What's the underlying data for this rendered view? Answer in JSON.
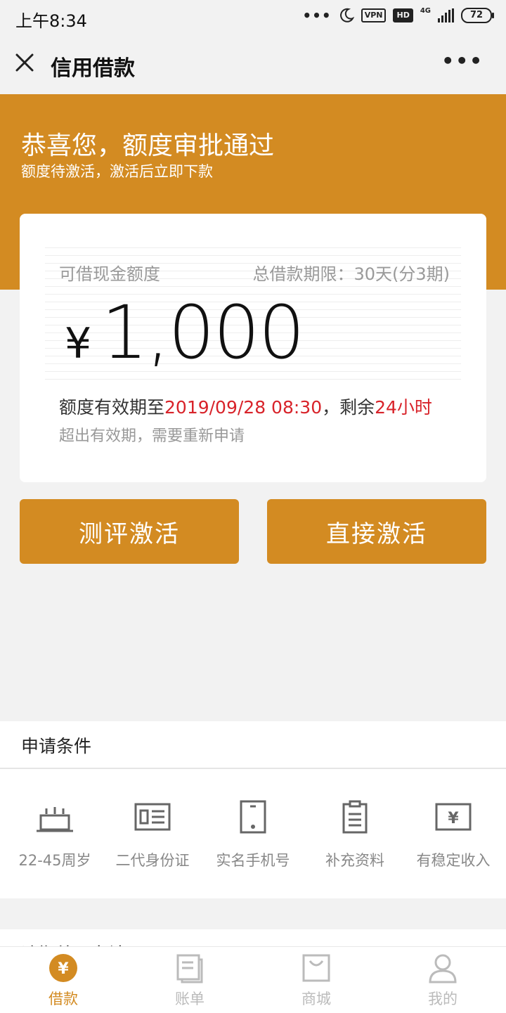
{
  "status_bar": {
    "time": "上午8:34",
    "dots": "•••",
    "vpn": "VPN",
    "hd": "HD",
    "network": "4G",
    "battery": "72"
  },
  "nav": {
    "title": "信用借款",
    "more": "•••"
  },
  "banner": {
    "title": "恭喜您，额度审批通过",
    "subtitle": "额度待激活，激活后立即下款"
  },
  "card": {
    "amount_label": "可借现金额度",
    "term_label": "总借款期限：30天(分3期)",
    "currency": "¥",
    "amount": "1,000",
    "validity_prefix": "额度有效期至",
    "validity_date": "2019/09/28 08:30",
    "validity_mid": "，剩余",
    "validity_remaining": "24小时",
    "validity_note": "超出有效期，需要重新申请"
  },
  "actions": {
    "evaluate_activate": "测评激活",
    "direct_activate": "直接激活"
  },
  "conditions": {
    "title": "申请条件",
    "items": [
      {
        "label": "22-45周岁",
        "icon": "cake-icon"
      },
      {
        "label": "二代身份证",
        "icon": "id-card-icon"
      },
      {
        "label": "实名手机号",
        "icon": "phone-icon"
      },
      {
        "label": "补充资料",
        "icon": "clipboard-icon"
      },
      {
        "label": "有稳定收入",
        "icon": "yuan-bill-icon"
      }
    ]
  },
  "next_section": {
    "title": "逾期处理办法"
  },
  "tabbar": {
    "items": [
      {
        "label": "借款",
        "icon": "yuan-circle-icon",
        "active": true
      },
      {
        "label": "账单",
        "icon": "bill-icon",
        "active": false
      },
      {
        "label": "商城",
        "icon": "shopping-bag-icon",
        "active": false
      },
      {
        "label": "我的",
        "icon": "user-icon",
        "active": false
      }
    ]
  },
  "colors": {
    "accent": "#d38b22",
    "highlight": "#d8232a",
    "background": "#f2f2f2"
  }
}
